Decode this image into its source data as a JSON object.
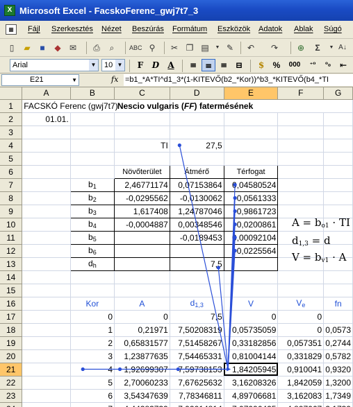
{
  "window": {
    "title": "Microsoft Excel - FacskoFerenc_gwj7t7_3",
    "app_icon": "X"
  },
  "menu": [
    "Fájl",
    "Szerkesztés",
    "Nézet",
    "Beszúrás",
    "Formátum",
    "Eszközök",
    "Adatok",
    "Ablak",
    "Súgó"
  ],
  "toolbar": {
    "icons": [
      "new-icon",
      "open-icon",
      "save-icon",
      "permission-icon",
      "email-icon",
      "print-icon",
      "print-preview-icon",
      "spelling-icon",
      "research-icon",
      "cut-icon",
      "copy-icon",
      "paste-icon",
      "format-painter-icon",
      "undo-icon",
      "redo-icon",
      "hyperlink-icon",
      "autosum-icon",
      "sort-ascending-icon"
    ],
    "sigma": "Σ"
  },
  "format_bar": {
    "font": "Arial",
    "size": "10",
    "bold": "F",
    "italic": "D",
    "underline": "A",
    "percent": "%",
    "thousands": "000"
  },
  "formula_bar": {
    "cell": "E21",
    "fx": "fx",
    "formula": "=b1_*A*TI^d1_3*(1-KITEVŐ(b2_*Kor))^b3_*KITEVŐ(b4_*TI"
  },
  "columns": [
    "A",
    "B",
    "C",
    "D",
    "E",
    "F",
    "G"
  ],
  "rows": [
    {
      "n": "1",
      "cells": [
        "FACSKÓ Ferenc (gwj7t7)",
        "",
        "",
        "Nescio vulgaris (FF) fatermésének",
        "",
        "",
        ""
      ]
    },
    {
      "n": "2",
      "cells": [
        "01.01.",
        "",
        "",
        "",
        "",
        "",
        ""
      ]
    },
    {
      "n": "3",
      "cells": [
        "",
        "",
        "",
        "",
        "",
        "",
        ""
      ]
    },
    {
      "n": "4",
      "cells": [
        "",
        "",
        "TI",
        "27,5",
        "",
        "",
        ""
      ]
    },
    {
      "n": "5",
      "cells": [
        "",
        "",
        "",
        "",
        "",
        "",
        ""
      ]
    },
    {
      "n": "6",
      "cells": [
        "",
        "",
        "Növőterület",
        "Átmérő",
        "Térfogat",
        "",
        ""
      ]
    },
    {
      "n": "7",
      "cells": [
        "",
        "b1",
        "2,46771174",
        "0,07153864",
        "0,04580524",
        "",
        ""
      ]
    },
    {
      "n": "8",
      "cells": [
        "",
        "b2",
        "-0,0295562",
        "-0,0130062",
        "-0,0561333",
        "",
        ""
      ]
    },
    {
      "n": "9",
      "cells": [
        "",
        "b3",
        "1,617408",
        "1,24787046",
        "0,9861723",
        "",
        ""
      ]
    },
    {
      "n": "10",
      "cells": [
        "",
        "b4",
        "-0,0004887",
        "0,00348546",
        "-0,0200861",
        "",
        ""
      ]
    },
    {
      "n": "11",
      "cells": [
        "",
        "b5",
        "",
        "-0,0189453",
        "0,00092104",
        "",
        ""
      ]
    },
    {
      "n": "12",
      "cells": [
        "",
        "b6",
        "",
        "",
        "-0,0225564",
        "",
        ""
      ]
    },
    {
      "n": "13",
      "cells": [
        "",
        "dh",
        "",
        "7,5",
        "",
        "",
        ""
      ]
    },
    {
      "n": "14",
      "cells": [
        "",
        "",
        "",
        "",
        "",
        "",
        ""
      ]
    },
    {
      "n": "15",
      "cells": [
        "",
        "",
        "",
        "",
        "",
        "",
        ""
      ]
    },
    {
      "n": "16",
      "cells": [
        "",
        "Kor",
        "A",
        "d1,3",
        "V",
        "Ve",
        "fn"
      ]
    },
    {
      "n": "17",
      "cells": [
        "",
        "0",
        "0",
        "7,5",
        "0",
        "0",
        ""
      ]
    },
    {
      "n": "18",
      "cells": [
        "",
        "1",
        "0,21971",
        "7,50208319",
        "0,05735059",
        "0",
        "0,0573"
      ]
    },
    {
      "n": "19",
      "cells": [
        "",
        "2",
        "0,65831577",
        "7,51458267",
        "0,33182856",
        "0,057351",
        "0,2744"
      ]
    },
    {
      "n": "20",
      "cells": [
        "",
        "3",
        "1,23877635",
        "7,54465331",
        "0,81004144",
        "0,331829",
        "0,5782"
      ]
    },
    {
      "n": "21",
      "cells": [
        "",
        "4",
        "1,92699307",
        "7,59738153",
        "1,84205945",
        "0,910041",
        "0,9320"
      ]
    },
    {
      "n": "22",
      "cells": [
        "",
        "5",
        "2,70060233",
        "7,67625632",
        "3,16208326",
        "1,842059",
        "1,3200"
      ]
    },
    {
      "n": "23",
      "cells": [
        "",
        "6",
        "3,54347639",
        "7,78346811",
        "4,89706681",
        "3,162083",
        "1,7349"
      ]
    },
    {
      "n": "24",
      "cells": [
        "",
        "7",
        "4,44283739",
        "7,92014814",
        "7,07096425",
        "4,897067",
        "2,1739"
      ]
    }
  ],
  "title_italic_part": "FF",
  "side_formulas": [
    "A = b",
    "d",
    "V = b"
  ]
}
